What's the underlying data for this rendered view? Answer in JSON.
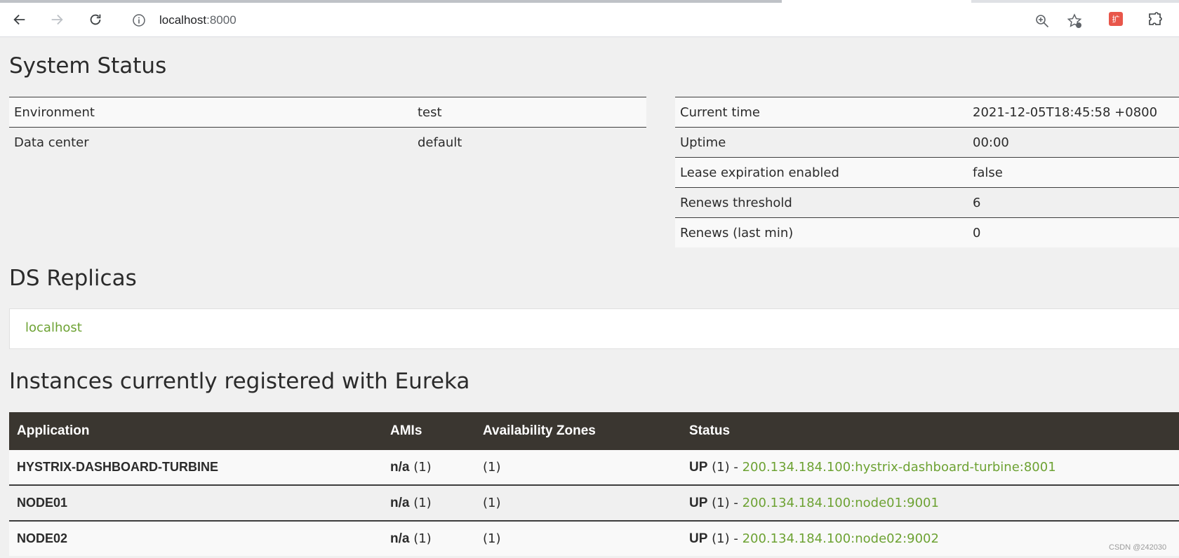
{
  "browser": {
    "url_host": "localhost",
    "url_port": ":8000",
    "ext_badge": "扩"
  },
  "headings": {
    "system_status": "System Status",
    "ds_replicas": "DS Replicas",
    "instances": "Instances currently registered with Eureka"
  },
  "status_left": [
    {
      "key": "Environment",
      "value": "test"
    },
    {
      "key": "Data center",
      "value": "default"
    }
  ],
  "status_right": [
    {
      "key": "Current time",
      "value": "2021-12-05T18:45:58 +0800"
    },
    {
      "key": "Uptime",
      "value": "00:00"
    },
    {
      "key": "Lease expiration enabled",
      "value": "false"
    },
    {
      "key": "Renews threshold",
      "value": "6"
    },
    {
      "key": "Renews (last min)",
      "value": "0"
    }
  ],
  "replicas": [
    "localhost"
  ],
  "instances": {
    "columns": [
      "Application",
      "AMIs",
      "Availability Zones",
      "Status"
    ],
    "rows": [
      {
        "app": "HYSTRIX-DASHBOARD-TURBINE",
        "ami": "n/a",
        "ami_count": "(1)",
        "zones": "(1)",
        "status": "UP",
        "status_count": "(1) -",
        "link": "200.134.184.100:hystrix-dashboard-turbine:8001"
      },
      {
        "app": "NODE01",
        "ami": "n/a",
        "ami_count": "(1)",
        "zones": "(1)",
        "status": "UP",
        "status_count": "(1) -",
        "link": "200.134.184.100:node01:9001"
      },
      {
        "app": "NODE02",
        "ami": "n/a",
        "ami_count": "(1)",
        "zones": "(1)",
        "status": "UP",
        "status_count": "(1) -",
        "link": "200.134.184.100:node02:9002"
      }
    ]
  },
  "watermark": "CSDN @242030",
  "colors": {
    "link": "#6da233",
    "header_bg": "#3a3630"
  }
}
